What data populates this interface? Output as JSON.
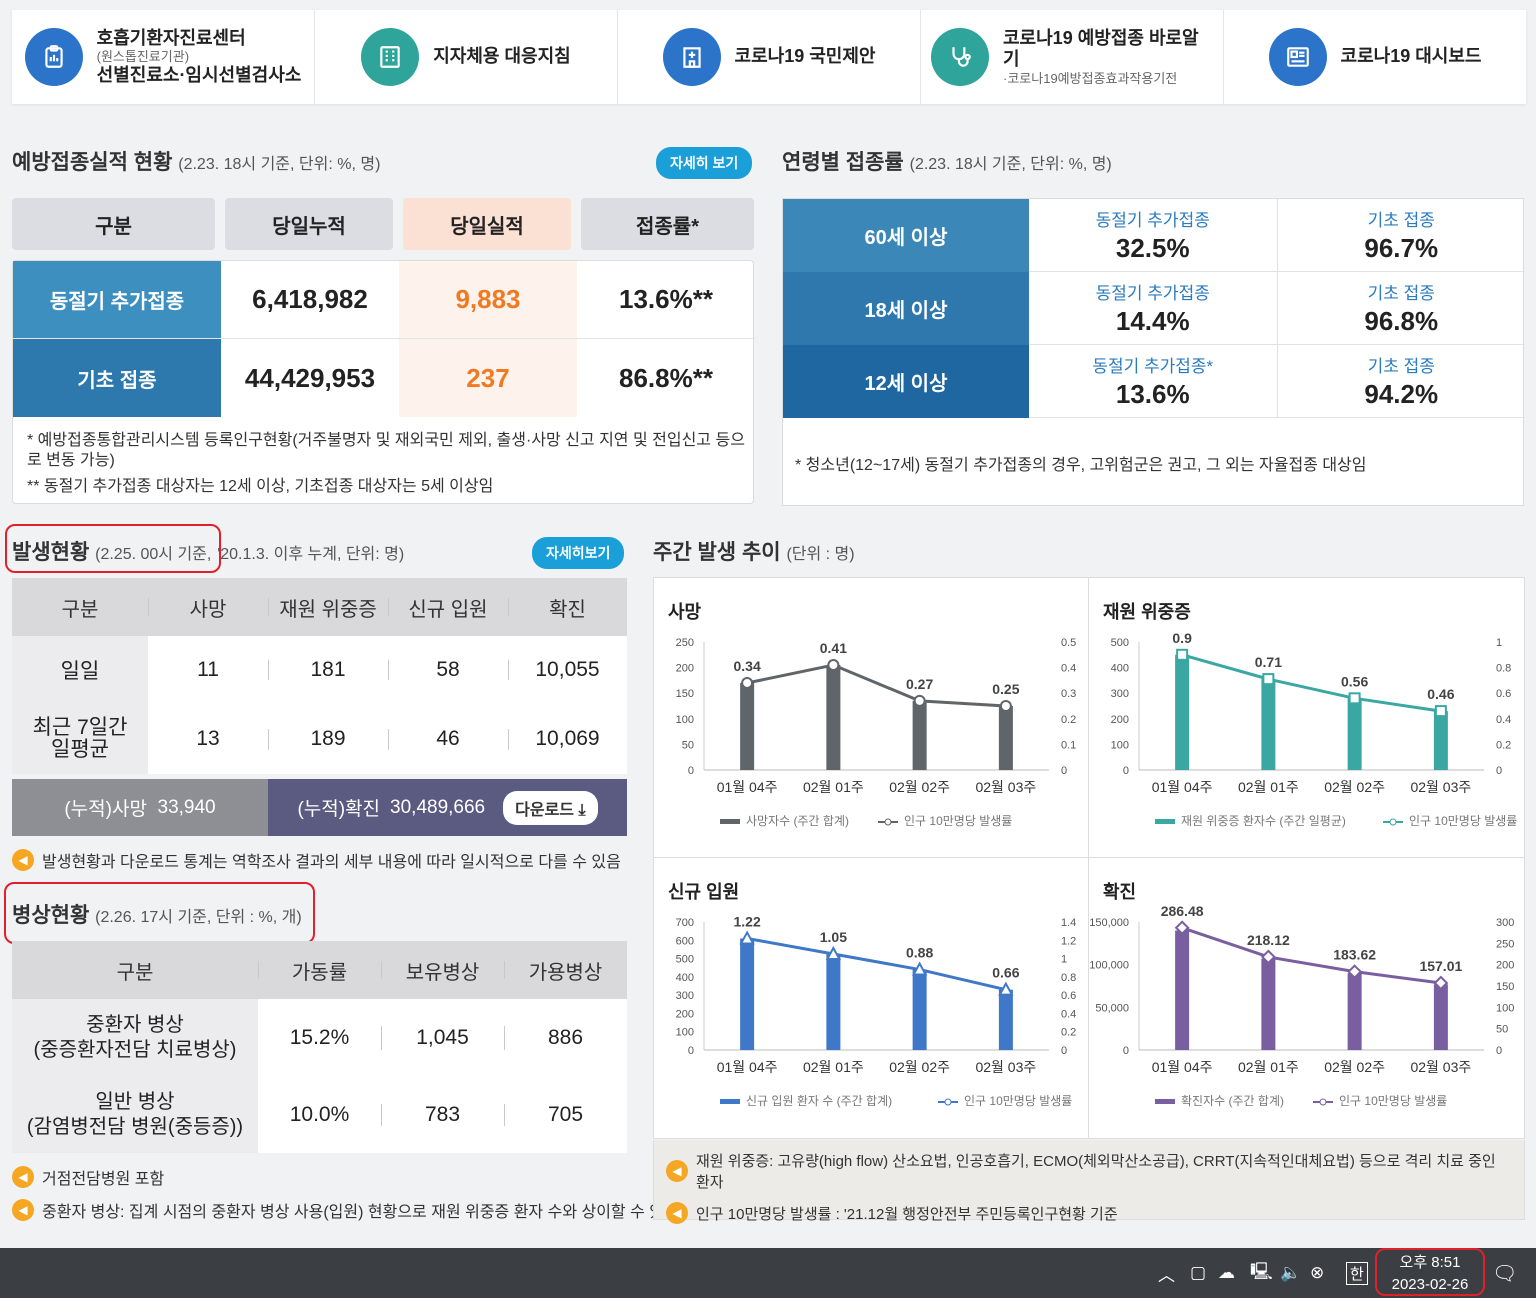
{
  "quick_links": [
    {
      "icon": "clipboard-icon",
      "color": "#2b74c9",
      "line1": "호흡기환자진료센터",
      "sub": "(원스톱진료기관)",
      "line2": "선별진료소·임시선별검사소"
    },
    {
      "icon": "building-icon",
      "color": "#2ea49a",
      "line1": "지자체용 대응지침",
      "sub": "",
      "line2": ""
    },
    {
      "icon": "hospital-icon",
      "color": "#2b74c9",
      "line1": "코로나19 국민제안",
      "sub": "",
      "line2": ""
    },
    {
      "icon": "stethoscope-icon",
      "color": "#2ea49a",
      "line1": "코로나19 예방접종 바로알기",
      "sub": "·코로나19예방접종효과작용기전",
      "line2": ""
    },
    {
      "icon": "dashboard-icon",
      "color": "#2b74c9",
      "line1": "코로나19 대시보드",
      "sub": "",
      "line2": ""
    }
  ],
  "vaccination": {
    "title": "예방접종실적 현황",
    "subtitle": "(2.23. 18시 기준, 단위: %, 명)",
    "detail_button": "자세히 보기",
    "headers": [
      "구분",
      "당일누적",
      "당일실적",
      "접종률*"
    ],
    "rows": [
      {
        "label": "동절기 추가접종",
        "cumulative": "6,418,982",
        "today": "9,883",
        "rate": "13.6%**"
      },
      {
        "label": "기초 접종",
        "cumulative": "44,429,953",
        "today": "237",
        "rate": "86.8%**"
      }
    ],
    "note1": "* 예방접종통합관리시스템 등록인구현황(거주불명자 및 재외국민 제외, 출생·사망 신고 지연 및 전입신고 등으로 변동 가능)",
    "note2": "** 동절기 추가접종 대상자는 12세 이상, 기초접종 대상자는 5세 이상임"
  },
  "age_rates": {
    "title": "연령별 접종률",
    "subtitle": "(2.23. 18시 기준, 단위: %, 명)",
    "rows": [
      {
        "label": "60세 이상",
        "booster_label": "동절기 추가접종",
        "booster": "32.5%",
        "primary_label": "기초 접종",
        "primary": "96.7%"
      },
      {
        "label": "18세 이상",
        "booster_label": "동절기 추가접종",
        "booster": "14.4%",
        "primary_label": "기초 접종",
        "primary": "96.8%"
      },
      {
        "label": "12세 이상",
        "booster_label": "동절기 추가접종*",
        "booster": "13.6%",
        "primary_label": "기초 접종",
        "primary": "94.2%"
      }
    ],
    "note": "* 청소년(12~17세) 동절기 추가접종의 경우, 고위험군은 권고, 그 외는 자율접종 대상임"
  },
  "outbreak": {
    "title": "발생현황",
    "subtitle_a": "(2.25. 00시 기준,",
    "subtitle_b": "'20.1.3. 이후 누계, 단위: 명)",
    "detail_button": "자세히보기",
    "headers": [
      "구분",
      "사망",
      "재원 위중증",
      "신규 입원",
      "확진"
    ],
    "rows": [
      {
        "label": "일일",
        "label2": "",
        "death": "11",
        "severe": "181",
        "admit": "58",
        "confirmed": "10,055"
      },
      {
        "label": "최근 7일간",
        "label2": "일평균",
        "death": "13",
        "severe": "189",
        "admit": "46",
        "confirmed": "10,069"
      }
    ],
    "cum_death_label": "(누적)사망",
    "cum_death": "33,940",
    "cum_conf_label": "(누적)확진",
    "cum_conf": "30,489,666",
    "download": "다운로드",
    "note": "발생현황과 다운로드 통계는 역학조사 결과의 세부 내용에 따라 일시적으로 다를 수 있음"
  },
  "beds": {
    "title": "병상현황",
    "subtitle": "(2.26. 17시 기준, 단위 : %, 개)",
    "headers": [
      "구분",
      "가동률",
      "보유병상",
      "가용병상"
    ],
    "rows": [
      {
        "l1": "중환자 병상",
        "l2": "(중증환자전담 치료병상)",
        "rate": "15.2%",
        "owned": "1,045",
        "avail": "886"
      },
      {
        "l1": "일반 병상",
        "l2": "(감염병전담 병원(중등증))",
        "rate": "10.0%",
        "owned": "783",
        "avail": "705"
      }
    ],
    "note1": "거점전담병원 포함",
    "note2": "중환자 병상: 집계 시점의 중환자 병상 사용(입원) 현황으로 재원 위중증 환자 수와 상이할 수 있음"
  },
  "weekly": {
    "title": "주간 발생 추이",
    "subtitle": "(단위 : 명)",
    "note1": "재원 위중증: 고유량(high flow) 산소요법, 인공호흡기, ECMO(체외막산소공급), CRRT(지속적인대체요법) 등으로 격리 치료 중인 환자",
    "note2": "인구 10만명당 발생률 : '21.12월 행정안전부 주민등록인구현황 기준"
  },
  "chart_data": [
    {
      "type": "bar",
      "title": "사망",
      "categories": [
        "01월 04주",
        "02월 01주",
        "02월 02주",
        "02월 03주"
      ],
      "series": [
        {
          "name": "사망자수 (주간 합계)",
          "values": [
            170,
            205,
            135,
            125
          ],
          "color": "#5f6568"
        },
        {
          "name": "인구 10만명당 발생률",
          "values": [
            0.34,
            0.41,
            0.27,
            0.25
          ],
          "color": "#5f6568",
          "axis": "right"
        }
      ],
      "ylim": [
        0,
        250
      ],
      "yticks": [
        0,
        50,
        100,
        150,
        200,
        250
      ],
      "y2lim": [
        0,
        0.5
      ],
      "y2ticks": [
        "0",
        "0.1",
        "0.2",
        "0.3",
        "0.4",
        "0.5"
      ],
      "labels": [
        "0.34",
        "0.41",
        "0.27",
        "0.25"
      ],
      "marker": "circle"
    },
    {
      "type": "bar",
      "title": "재원 위중증",
      "categories": [
        "01월 04주",
        "02월 01주",
        "02월 02주",
        "02월 03주"
      ],
      "series": [
        {
          "name": "재원 위중증 환자수 (주간 일평균)",
          "values": [
            450,
            355,
            280,
            230
          ],
          "color": "#3aa7a3"
        },
        {
          "name": "인구 10만명당 발생률",
          "values": [
            0.9,
            0.71,
            0.56,
            0.46
          ],
          "color": "#3aa7a3",
          "axis": "right"
        }
      ],
      "ylim": [
        0,
        500
      ],
      "yticks": [
        0,
        100,
        200,
        300,
        400,
        500
      ],
      "y2lim": [
        0,
        1
      ],
      "y2ticks": [
        "0",
        "0.2",
        "0.4",
        "0.6",
        "0.8",
        "1"
      ],
      "labels": [
        "0.9",
        "0.71",
        "0.56",
        "0.46"
      ],
      "marker": "square"
    },
    {
      "type": "bar",
      "title": "신규 입원",
      "categories": [
        "01월 04주",
        "02월 01주",
        "02월 02주",
        "02월 03주"
      ],
      "series": [
        {
          "name": "신규 입원 환자 수 (주간 합계)",
          "values": [
            610,
            525,
            440,
            330
          ],
          "color": "#3f78c8"
        },
        {
          "name": "인구 10만명당 발생률",
          "values": [
            1.22,
            1.05,
            0.88,
            0.66
          ],
          "color": "#3f78c8",
          "axis": "right"
        }
      ],
      "ylim": [
        0,
        700
      ],
      "yticks": [
        0,
        100,
        200,
        300,
        400,
        500,
        600,
        700
      ],
      "y2lim": [
        0,
        1.4
      ],
      "y2ticks": [
        "0",
        "0.2",
        "0.4",
        "0.6",
        "0.8",
        "1",
        "1.2",
        "1.4"
      ],
      "labels": [
        "1.22",
        "1.05",
        "0.88",
        "0.66"
      ],
      "marker": "triangle"
    },
    {
      "type": "bar",
      "title": "확진",
      "categories": [
        "01월 04주",
        "02월 01주",
        "02월 02주",
        "02월 03주"
      ],
      "series": [
        {
          "name": "확진자수 (주간 합계)",
          "values": [
            140000,
            107000,
            90000,
            77000
          ],
          "color": "#7a5fa0"
        },
        {
          "name": "인구 10만명당 발생률",
          "values": [
            286.48,
            218.12,
            183.62,
            157.01
          ],
          "color": "#7a5fa0",
          "axis": "right"
        }
      ],
      "ylim": [
        0,
        150000
      ],
      "yticks": [
        "0",
        "50,000",
        "100,000",
        "150,000"
      ],
      "y2lim": [
        0,
        300
      ],
      "y2ticks": [
        "0",
        "50",
        "100",
        "150",
        "200",
        "250",
        "300"
      ],
      "labels": [
        "286.48",
        "218.12",
        "183.62",
        "157.01"
      ],
      "marker": "diamond"
    }
  ],
  "taskbar": {
    "time": "오후 8:51",
    "date": "2023-02-26",
    "ime": "한"
  }
}
